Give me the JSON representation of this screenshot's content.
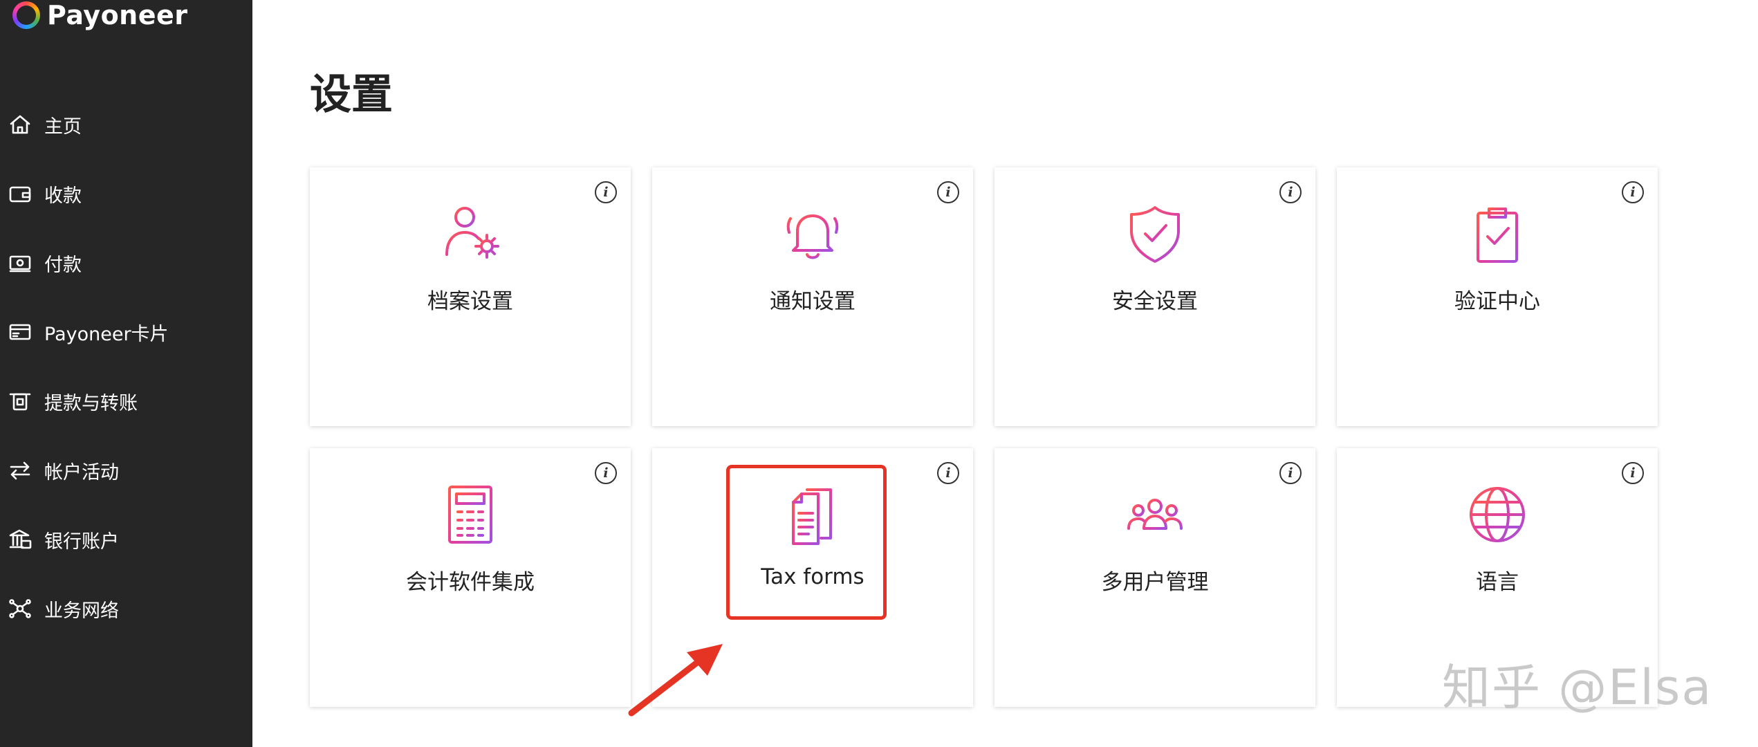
{
  "brand": {
    "name": "Payoneer"
  },
  "sidebar": {
    "items": [
      {
        "label": "主页",
        "icon": "home-icon"
      },
      {
        "label": "收款",
        "icon": "wallet-icon"
      },
      {
        "label": "付款",
        "icon": "cash-icon"
      },
      {
        "label": "Payoneer卡片",
        "icon": "card-icon"
      },
      {
        "label": "提款与转账",
        "icon": "withdraw-icon"
      },
      {
        "label": "帐户活动",
        "icon": "transfer-arrows-icon"
      },
      {
        "label": "银行账户",
        "icon": "bank-icon"
      },
      {
        "label": "业务网络",
        "icon": "network-icon"
      }
    ]
  },
  "main": {
    "title": "设置",
    "cards": [
      {
        "label": "档案设置",
        "icon": "profile-gear-icon"
      },
      {
        "label": "通知设置",
        "icon": "bell-icon"
      },
      {
        "label": "安全设置",
        "icon": "shield-check-icon"
      },
      {
        "label": "验证中心",
        "icon": "clipboard-check-icon"
      },
      {
        "label": "会计软件集成",
        "icon": "calculator-icon"
      },
      {
        "label": "Tax forms",
        "icon": "documents-icon"
      },
      {
        "label": "多用户管理",
        "icon": "users-group-icon"
      },
      {
        "label": "语言",
        "icon": "globe-icon"
      }
    ],
    "info_glyph": "i"
  },
  "annotation": {
    "highlighted_card": "Tax forms",
    "highlight_color": "#e53424"
  },
  "watermark": "知乎 @Elsa",
  "colors": {
    "sidebar_bg": "#262626",
    "icon_gradient": [
      "#ff5a4e",
      "#e040a0",
      "#a050e0"
    ]
  }
}
